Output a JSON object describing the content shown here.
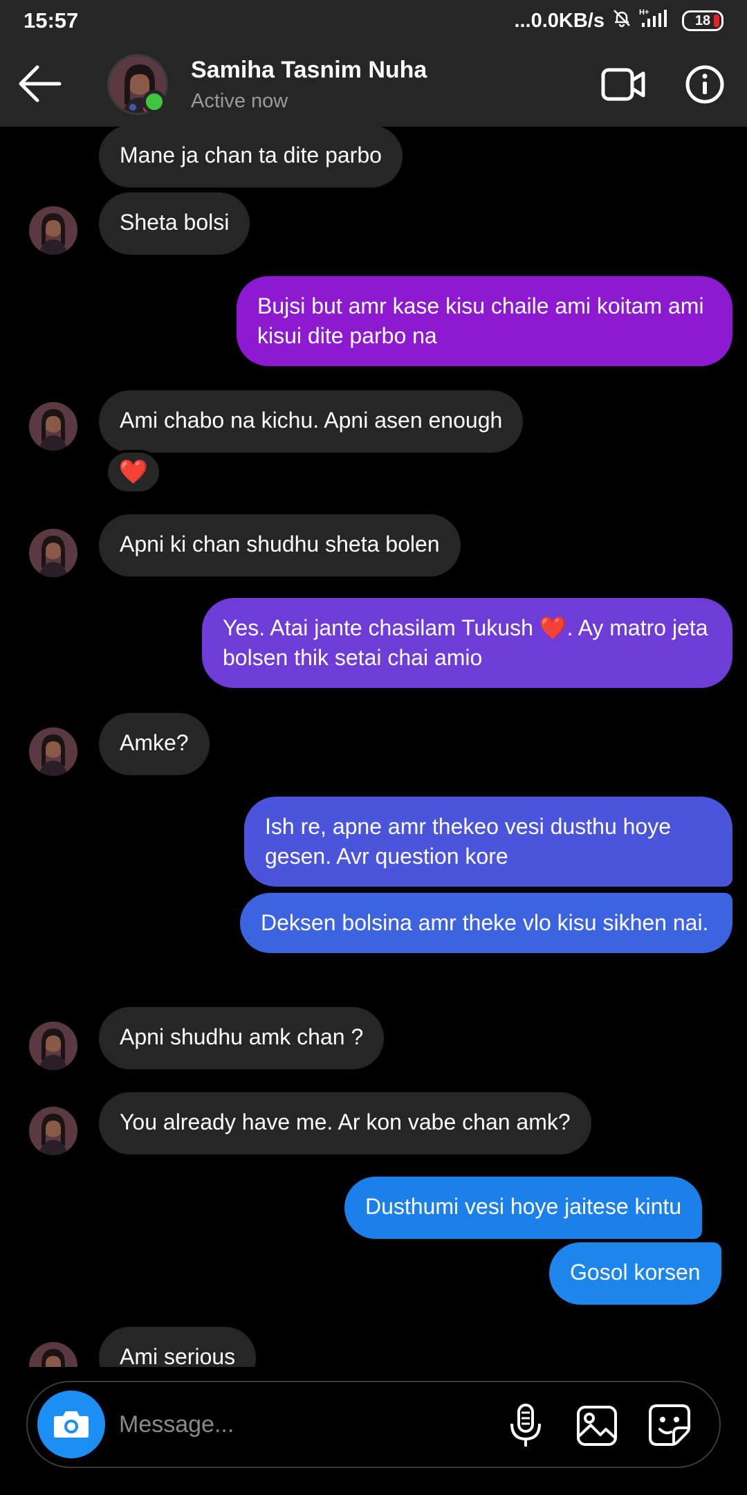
{
  "status_bar": {
    "time": "15:57",
    "network_speed": "...0.0KB/s",
    "network_type": "H+",
    "battery": "18"
  },
  "header": {
    "contact_name": "Samiha Tasnim Nuha",
    "contact_status": "Active now",
    "icons": [
      "back-arrow-icon",
      "video-call-icon",
      "info-icon"
    ]
  },
  "messages": [
    {
      "side": "in",
      "text": "Mane ja chan ta dite parbo",
      "avatar": false
    },
    {
      "side": "in",
      "text": "Sheta bolsi",
      "avatar": true
    },
    {
      "side": "out",
      "text": "Bujsi but amr kase kisu chaile ami koitam ami kisui dite parbo na",
      "color": "#8d1ad0"
    },
    {
      "side": "in",
      "text": "Ami chabo na kichu. Apni asen enough",
      "avatar": true,
      "reaction": "❤️"
    },
    {
      "side": "in",
      "text": "Apni ki chan shudhu sheta bolen",
      "avatar": true
    },
    {
      "side": "out",
      "text": "Yes. Atai jante chasilam Tukush ❤️. Ay matro jeta bolsen thik setai chai amio",
      "color": "#6f3cd8"
    },
    {
      "side": "in",
      "text": "Amke?",
      "avatar": true
    },
    {
      "side": "out",
      "text": "Ish re, apne amr thekeo vesi dusthu hoye gesen. Avr question kore",
      "color": "#4a55dc"
    },
    {
      "side": "out",
      "text": "Deksen bolsina amr theke vlo kisu sikhen nai.",
      "color": "#3c64e0"
    },
    {
      "side": "in",
      "text": "Apni shudhu amk chan ?",
      "avatar": true
    },
    {
      "side": "in",
      "text": "You already have me. Ar kon vabe chan amk?",
      "avatar": true
    },
    {
      "side": "out",
      "text": "Dusthumi vesi hoye jaitese kintu",
      "color": "#1c80ea"
    },
    {
      "side": "out",
      "text": "Gosol korsen",
      "color": "#1c86ec"
    },
    {
      "side": "in",
      "text": "Ami serious",
      "avatar": true
    }
  ],
  "composer": {
    "placeholder": "Message...",
    "icons": [
      "camera-icon",
      "microphone-icon",
      "gallery-icon",
      "sticker-icon"
    ]
  }
}
